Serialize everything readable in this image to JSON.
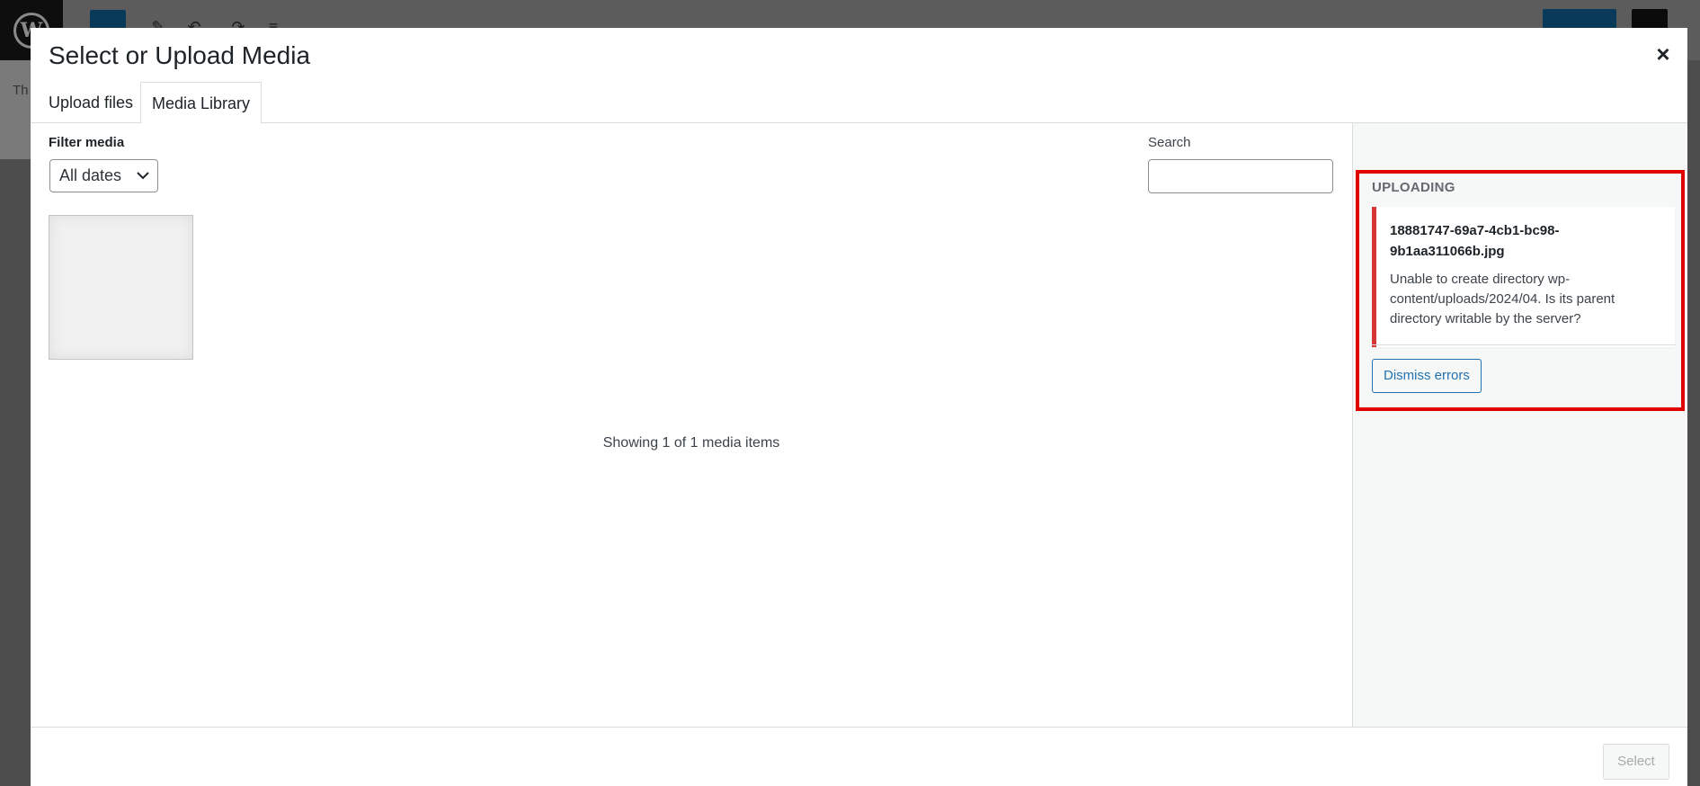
{
  "background_editor": {
    "left_strip_text": "Th"
  },
  "modal": {
    "title": "Select or Upload Media",
    "close_label": "×"
  },
  "tabs": [
    {
      "label": "Upload files",
      "active": false
    },
    {
      "label": "Media Library",
      "active": true
    }
  ],
  "filters": {
    "label": "Filter media",
    "date_select": {
      "selected": "All dates"
    },
    "search_label": "Search",
    "search_value": ""
  },
  "media": {
    "showing_text": "Showing 1 of 1 media items",
    "items": 1
  },
  "sidebar": {
    "uploading_title": "UPLOADING",
    "error": {
      "filename": "18881747-69a7-4cb1-bc98-9b1aa311066b.jpg",
      "message": "Unable to create directory wp-content/uploads/2024/04. Is its parent directory writable by the server?"
    },
    "dismiss_label": "Dismiss errors",
    "highlight_color": "#e00000",
    "error_color": "#d63638"
  },
  "footer": {
    "select_label": "Select"
  }
}
